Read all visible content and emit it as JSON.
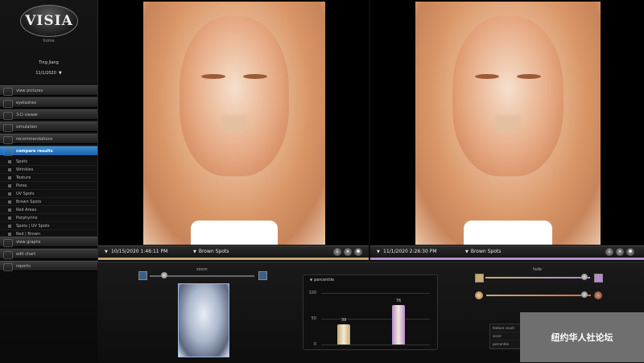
{
  "app": {
    "logo_text": "VISIA",
    "home_label": "home"
  },
  "patient": {
    "name": "Ting Jiang",
    "date": "11/1/2020"
  },
  "menu": [
    {
      "label": "view pictures",
      "active": false
    },
    {
      "label": "eyelashes",
      "active": false
    },
    {
      "label": "3-D viewer",
      "active": false
    },
    {
      "label": "simulation",
      "active": false
    },
    {
      "label": "recommendations",
      "active": false
    },
    {
      "label": "compare results",
      "active": true
    }
  ],
  "submenu": [
    "Spots",
    "Wrinkles",
    "Texture",
    "Pores",
    "UV Spots",
    "Brown Spots",
    "Red Areas",
    "Porphyrins",
    "Spots | UV Spots",
    "Red | Brown"
  ],
  "menu_after": [
    {
      "label": "view graphs"
    },
    {
      "label": "edit chart"
    },
    {
      "label": "reports"
    }
  ],
  "left_panel": {
    "date": "10/15/2020 1:46:11 PM",
    "mode": "Brown Spots"
  },
  "right_panel": {
    "date": "11/1/2020 2:26:30 PM",
    "mode": "Brown Spots"
  },
  "bottom": {
    "zoom_label": "zoom",
    "fade_label": "fade",
    "info_rows": [
      "feature count",
      "score",
      "percentile"
    ]
  },
  "chart_data": {
    "type": "bar",
    "title": "percentile",
    "categories": [
      "10/15/2020",
      "11/1/2020"
    ],
    "values": [
      39,
      76
    ],
    "ylim": [
      0,
      100
    ],
    "yticks": [
      0,
      50,
      100
    ],
    "colors": [
      "#c9a872",
      "#b58ad0"
    ]
  },
  "watermark": "纽约华人社论坛"
}
